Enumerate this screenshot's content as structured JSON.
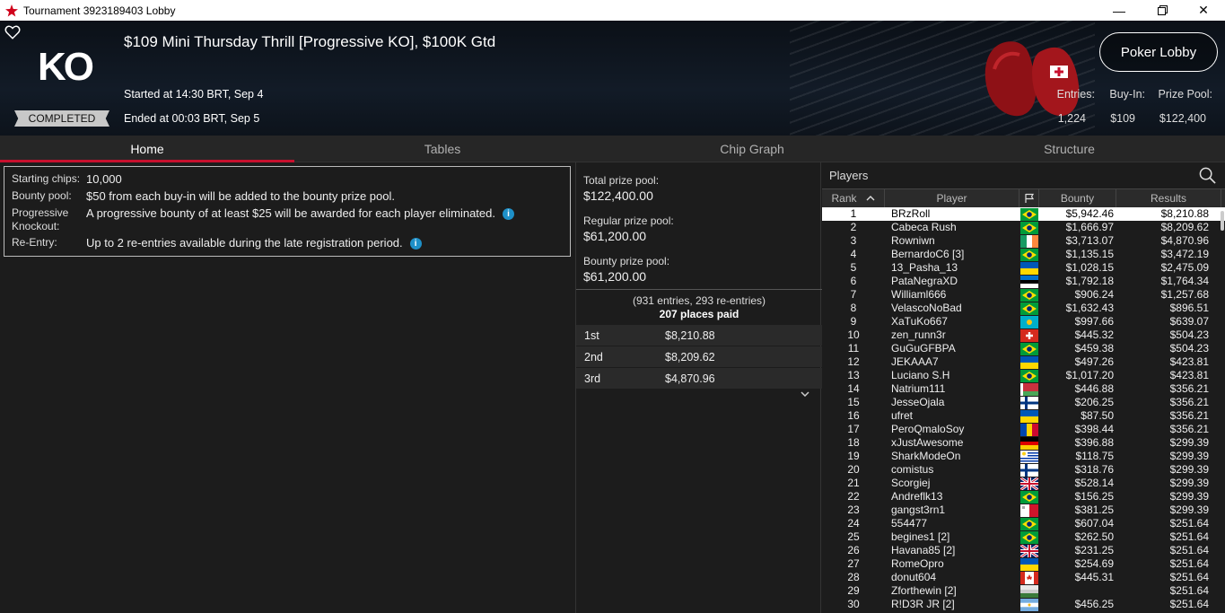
{
  "window": {
    "title": "Tournament 3923189403 Lobby"
  },
  "header": {
    "logo": "KO",
    "status": "COMPLETED",
    "name": "$109 Mini Thursday Thrill [Progressive KO], $100K Gtd",
    "started": "Started at 14:30 BRT, Sep 4",
    "ended": "Ended at 00:03 BRT, Sep 5",
    "lobby_button": "Poker Lobby",
    "stats": [
      {
        "label": "Entries:",
        "value": "1,224"
      },
      {
        "label": "Buy-In:",
        "value": "$109"
      },
      {
        "label": "Prize Pool:",
        "value": "$122,400"
      }
    ]
  },
  "tabs": [
    "Home",
    "Tables",
    "Chip Graph",
    "Structure"
  ],
  "info": [
    {
      "k": "Starting chips:",
      "v": "10,000",
      "icon": false
    },
    {
      "k": "Bounty pool:",
      "v": "$50 from each buy-in will be added to the bounty prize pool.",
      "icon": false
    },
    {
      "k": "Progressive Knockout:",
      "v": "A progressive bounty of at least $25 will be awarded for each player eliminated.",
      "icon": true
    },
    {
      "k": "Re-Entry:",
      "v": "Up to 2 re-entries available during the late registration period.",
      "icon": true
    }
  ],
  "prize": {
    "total_label": "Total prize pool:",
    "total": "$122,400.00",
    "regular_label": "Regular prize pool:",
    "regular": "$61,200.00",
    "bounty_label": "Bounty prize pool:",
    "bounty": "$61,200.00",
    "entries": "(931 entries, 293 re-entries)",
    "places": "207 places paid",
    "places_list": [
      {
        "place": "1st",
        "amount": "$8,210.88"
      },
      {
        "place": "2nd",
        "amount": "$8,209.62"
      },
      {
        "place": "3rd",
        "amount": "$4,870.96"
      }
    ]
  },
  "players": {
    "title": "Players",
    "columns": [
      "Rank",
      "Player",
      "Bounty",
      "Results"
    ],
    "rows": [
      [
        "1",
        "BRzRoll",
        "br",
        "$5,942.46",
        "$8,210.88"
      ],
      [
        "2",
        "Cabeca Rush",
        "br",
        "$1,666.97",
        "$8,209.62"
      ],
      [
        "3",
        "Rowniwn",
        "ie",
        "$3,713.07",
        "$4,870.96"
      ],
      [
        "4",
        "BernardoC6 [3]",
        "br",
        "$1,135.15",
        "$3,472.19"
      ],
      [
        "5",
        "13_Pasha_13",
        "ua",
        "$1,028.15",
        "$2,475.09"
      ],
      [
        "6",
        "PataNegraXD",
        "ee",
        "$1,792.18",
        "$1,764.34"
      ],
      [
        "7",
        "Williaml666",
        "br",
        "$906.24",
        "$1,257.68"
      ],
      [
        "8",
        "VelascoNoBad",
        "br",
        "$1,632.43",
        "$896.51"
      ],
      [
        "9",
        "XaTuKo667",
        "kz",
        "$997.66",
        "$639.07"
      ],
      [
        "10",
        "zen_runn3r",
        "ch",
        "$445.32",
        "$504.23"
      ],
      [
        "11",
        "GuGuGFBPA",
        "br",
        "$459.38",
        "$504.23"
      ],
      [
        "12",
        "JEKAAA7",
        "ua",
        "$497.26",
        "$423.81"
      ],
      [
        "13",
        "Luciano S.H",
        "br",
        "$1,017.20",
        "$423.81"
      ],
      [
        "14",
        "Natrium111",
        "by",
        "$446.88",
        "$356.21"
      ],
      [
        "15",
        "JesseOjala",
        "fi",
        "$206.25",
        "$356.21"
      ],
      [
        "16",
        "ufret",
        "ua",
        "$87.50",
        "$356.21"
      ],
      [
        "17",
        "PeroQmaloSoy",
        "md",
        "$398.44",
        "$356.21"
      ],
      [
        "18",
        "xJustAwesome",
        "de",
        "$396.88",
        "$299.39"
      ],
      [
        "19",
        "SharkModeOn",
        "uy",
        "$118.75",
        "$299.39"
      ],
      [
        "20",
        "comistus",
        "fi",
        "$318.76",
        "$299.39"
      ],
      [
        "21",
        "Scorgiej",
        "gb",
        "$528.14",
        "$299.39"
      ],
      [
        "22",
        "Andreflk13",
        "br",
        "$156.25",
        "$299.39"
      ],
      [
        "23",
        "gangst3rn1",
        "mt",
        "$381.25",
        "$299.39"
      ],
      [
        "24",
        "554477",
        "br",
        "$607.04",
        "$251.64"
      ],
      [
        "25",
        "begines1 [2]",
        "br",
        "$262.50",
        "$251.64"
      ],
      [
        "26",
        "Havana85 [2]",
        "gb",
        "$231.25",
        "$251.64"
      ],
      [
        "27",
        "RomeOpro",
        "ua",
        "$254.69",
        "$251.64"
      ],
      [
        "28",
        "donut604",
        "ca",
        "$445.31",
        "$251.64"
      ],
      [
        "29",
        "Zforthewin [2]",
        "xx",
        "",
        "$251.64"
      ],
      [
        "30",
        "R!D3R JR [2]",
        "ar",
        "$456.25",
        "$251.64"
      ]
    ]
  }
}
